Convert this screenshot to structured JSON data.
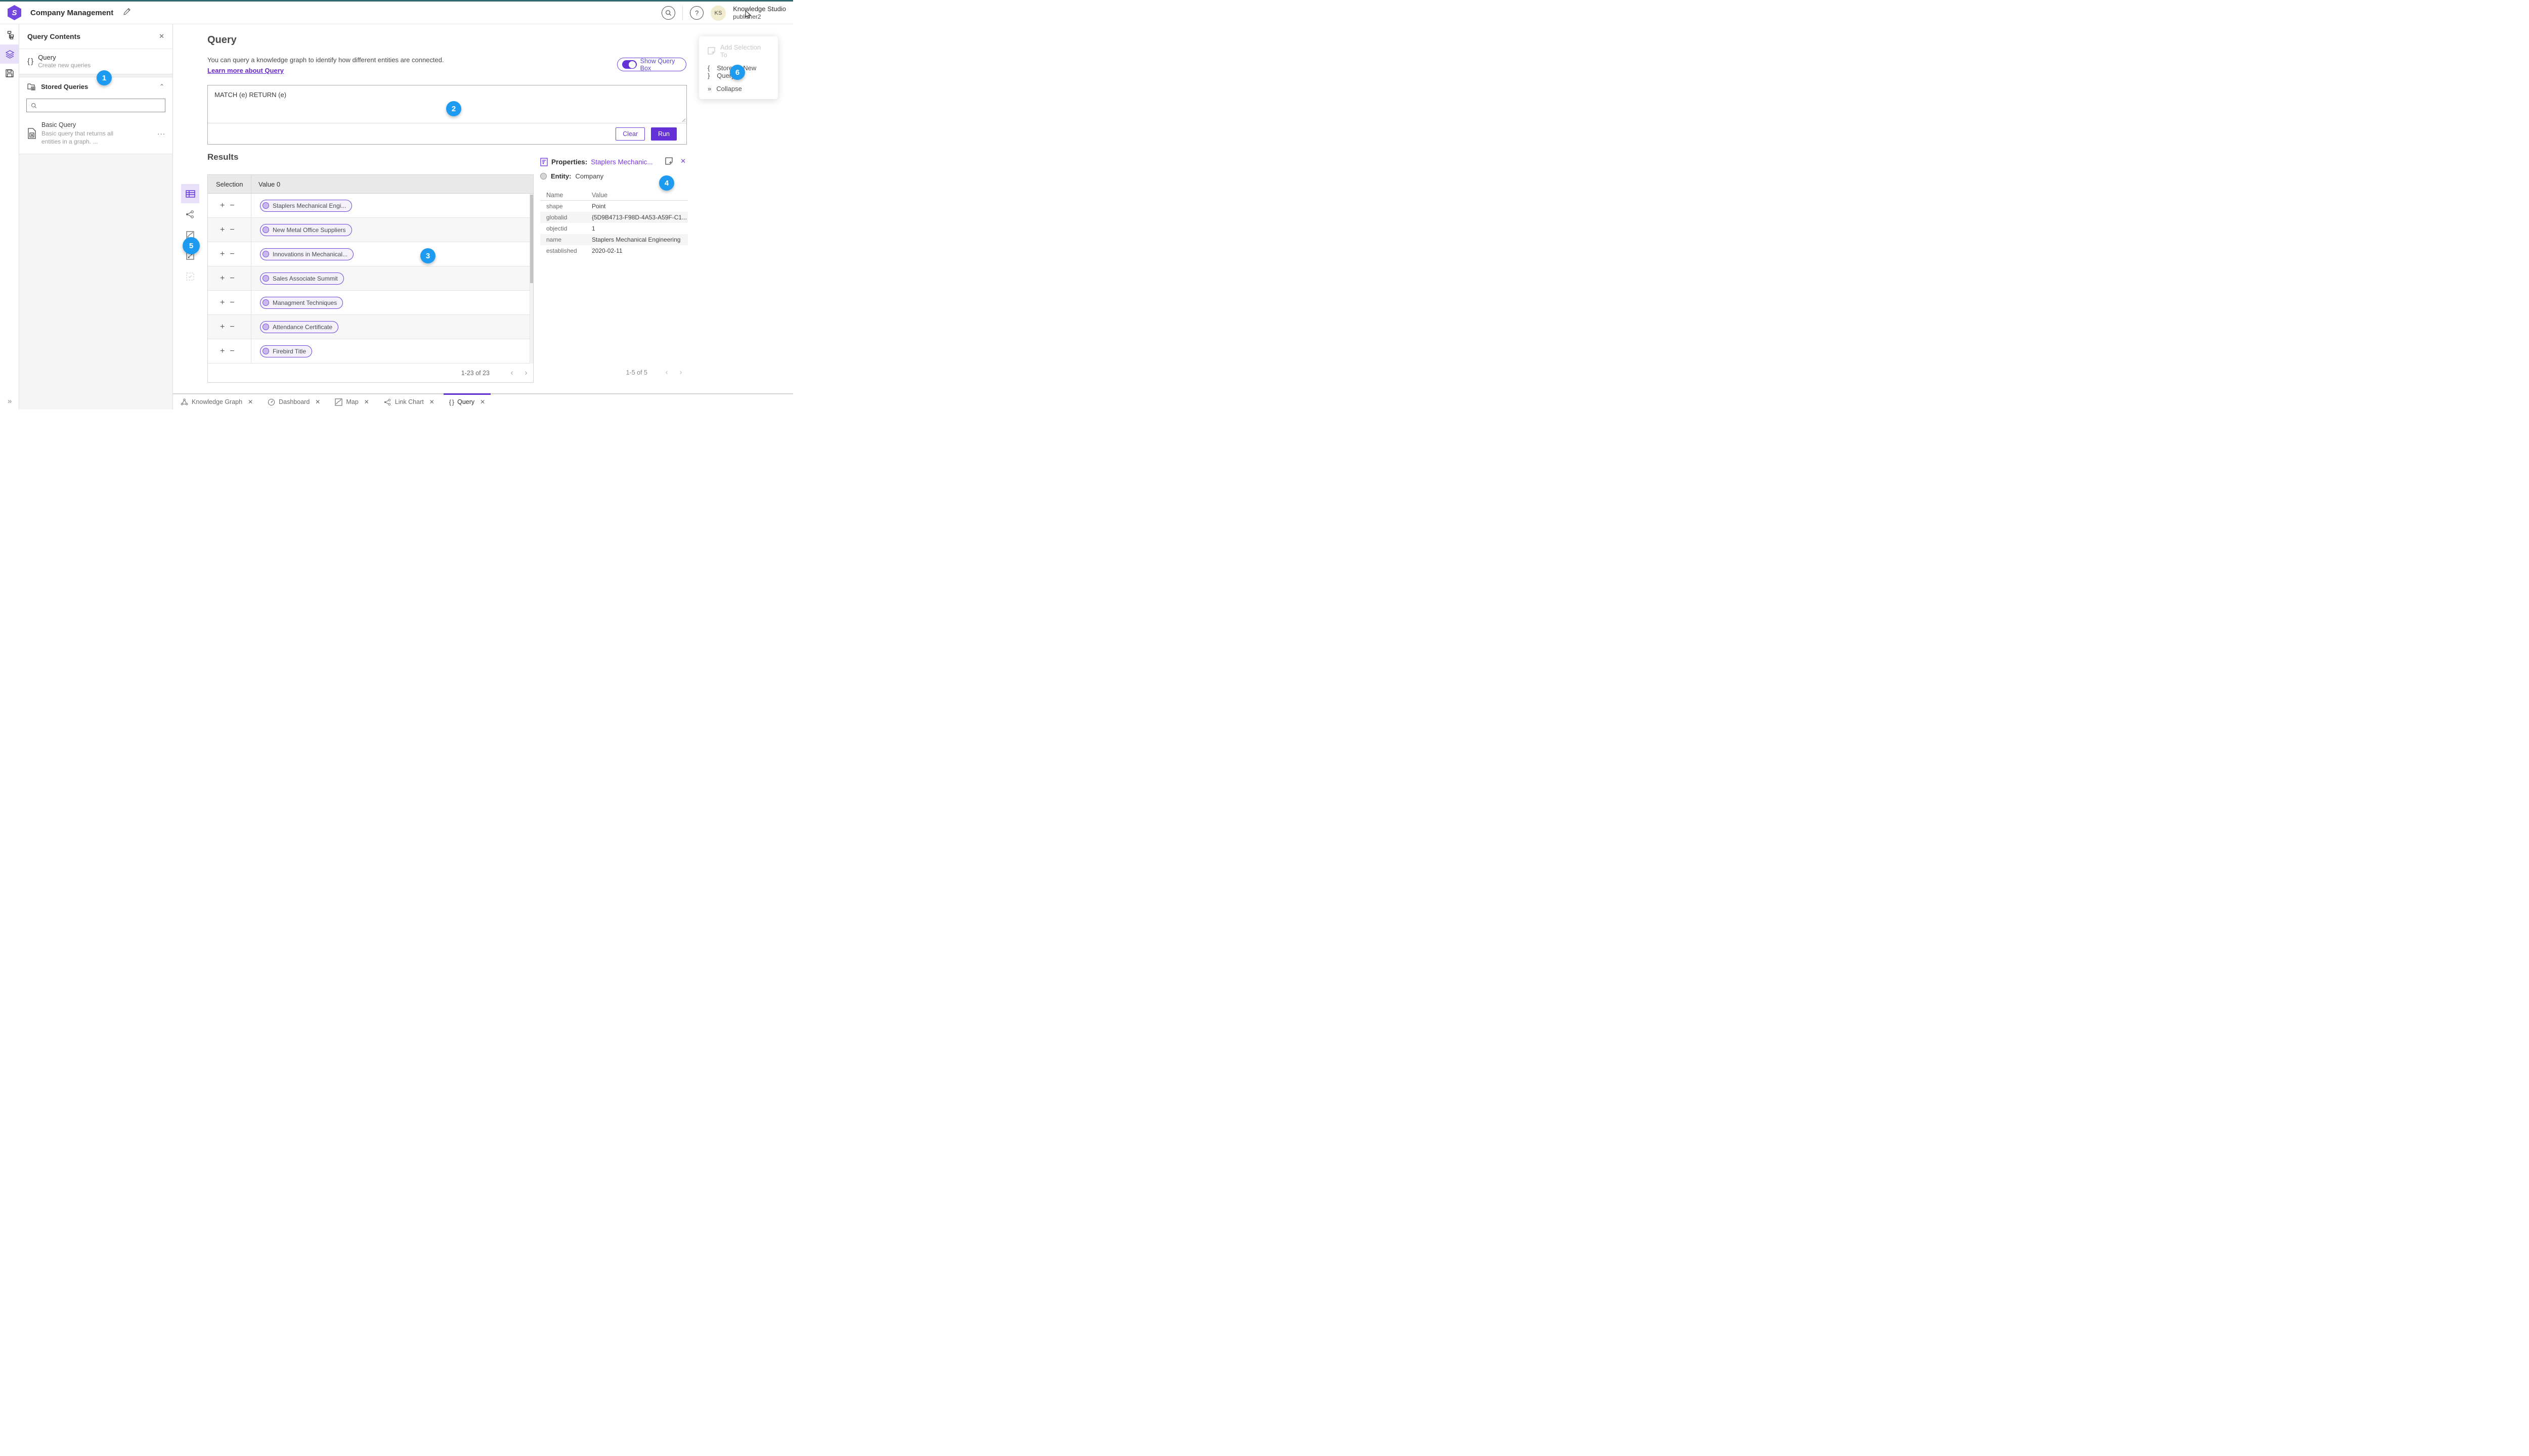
{
  "icons": {
    "close": "✕",
    "ellipsis": "···",
    "chevron_up": "⌃",
    "chevron_left": "‹",
    "chevron_right": "›",
    "expand": "»",
    "braces": "{ }",
    "plus": "+",
    "minus": "−",
    "question": "?",
    "logo_glyph": "S"
  },
  "header": {
    "app_title": "Company Management",
    "user_name": "Knowledge Studio",
    "user_role": "publisher2",
    "avatar_initials": "KS"
  },
  "left_panel": {
    "title": "Query Contents",
    "query_item": {
      "title": "Query",
      "subtitle": "Create new queries"
    },
    "stored_queries": {
      "title": "Stored Queries",
      "item": {
        "title": "Basic Query",
        "description": "Basic query that returns all entities in a graph. ..."
      }
    }
  },
  "main": {
    "title": "Query",
    "description": "You can query a knowledge graph to identify how different entities are connected.",
    "learn_more": "Learn more about Query",
    "toggle_label": "Show Query Box",
    "query_text": "MATCH (e) RETURN (e)",
    "clear_label": "Clear",
    "run_label": "Run"
  },
  "results": {
    "title": "Results",
    "col_selection": "Selection",
    "col_value": "Value 0",
    "rows": [
      "Staplers Mechanical Engi...",
      "New Metal Office Suppliers",
      "Innovations in Mechanical...",
      "Sales Associate Summit",
      "Managment Techniques",
      "Attendance Certificate",
      "Firebird Title"
    ],
    "pagination": "1-23 of 23"
  },
  "properties": {
    "label": "Properties:",
    "entity_link": "Staplers Mechanic...",
    "entity_label": "Entity:",
    "entity_type": "Company",
    "col_name": "Name",
    "col_value": "Value",
    "rows": [
      {
        "name": "shape",
        "value": "Point"
      },
      {
        "name": "globalid",
        "value": "{5D9B4713-F98D-4A53-A59F-C1..."
      },
      {
        "name": "objectid",
        "value": "1"
      },
      {
        "name": "name",
        "value": "Staplers Mechanical Engineering"
      },
      {
        "name": "established",
        "value": "2020-02-11"
      }
    ],
    "pagination": "1-5 of 5"
  },
  "context_menu": {
    "item_add": "Add Selection To",
    "item_store": "Store as New Query",
    "item_collapse": "Collapse"
  },
  "tabs": {
    "knowledge_graph": "Knowledge Graph",
    "dashboard": "Dashboard",
    "map": "Map",
    "link_chart": "Link Chart",
    "query": "Query"
  },
  "badges": {
    "b1": "1",
    "b2": "2",
    "b3": "3",
    "b4": "4",
    "b5": "5",
    "b6": "6"
  },
  "colors": {
    "accent_purple": "#6331d6",
    "link_purple": "#6a28c9",
    "badge_blue": "#1d9bf0",
    "topbar_teal": "#2e6a6e",
    "rail_selected_bg": "#e8e0f8",
    "pill_fill": "#f4f1fb",
    "pill_border": "#6b46d9"
  }
}
